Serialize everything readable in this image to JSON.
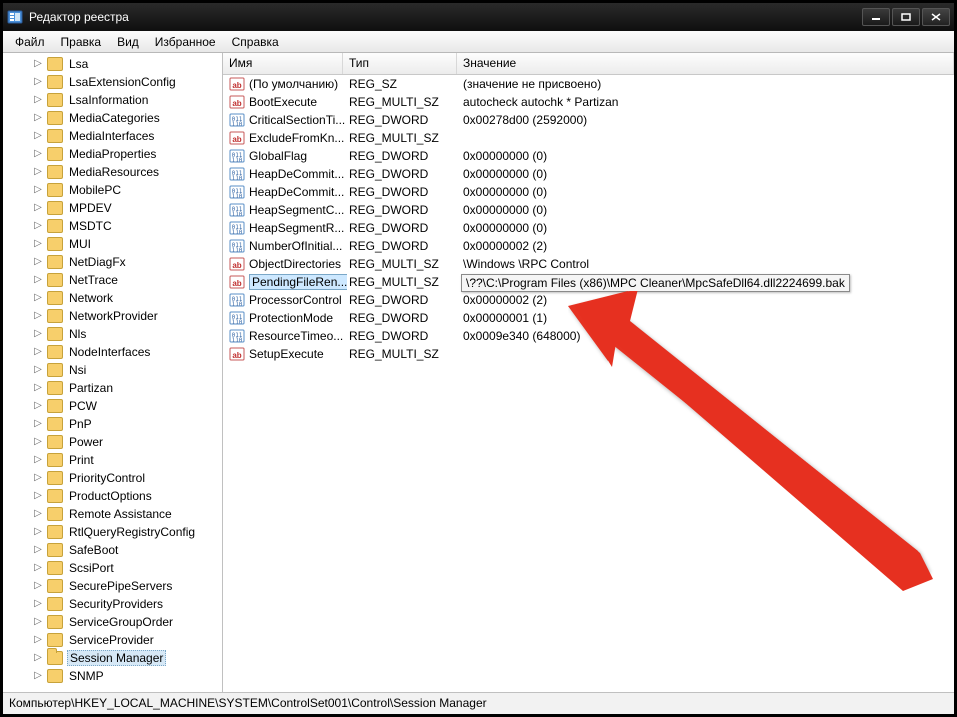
{
  "window": {
    "title": "Редактор реестра"
  },
  "menu": {
    "file": "Файл",
    "edit": "Правка",
    "view": "Вид",
    "favorites": "Избранное",
    "help": "Справка"
  },
  "columns": {
    "name": "Имя",
    "type": "Тип",
    "value": "Значение"
  },
  "tree": [
    {
      "label": "Lsa",
      "selected": false
    },
    {
      "label": "LsaExtensionConfig",
      "selected": false
    },
    {
      "label": "LsaInformation",
      "selected": false
    },
    {
      "label": "MediaCategories",
      "selected": false
    },
    {
      "label": "MediaInterfaces",
      "selected": false
    },
    {
      "label": "MediaProperties",
      "selected": false
    },
    {
      "label": "MediaResources",
      "selected": false
    },
    {
      "label": "MobilePC",
      "selected": false
    },
    {
      "label": "MPDEV",
      "selected": false
    },
    {
      "label": "MSDTC",
      "selected": false
    },
    {
      "label": "MUI",
      "selected": false
    },
    {
      "label": "NetDiagFx",
      "selected": false
    },
    {
      "label": "NetTrace",
      "selected": false
    },
    {
      "label": "Network",
      "selected": false
    },
    {
      "label": "NetworkProvider",
      "selected": false
    },
    {
      "label": "Nls",
      "selected": false
    },
    {
      "label": "NodeInterfaces",
      "selected": false
    },
    {
      "label": "Nsi",
      "selected": false
    },
    {
      "label": "Partizan",
      "selected": false
    },
    {
      "label": "PCW",
      "selected": false
    },
    {
      "label": "PnP",
      "selected": false
    },
    {
      "label": "Power",
      "selected": false
    },
    {
      "label": "Print",
      "selected": false
    },
    {
      "label": "PriorityControl",
      "selected": false
    },
    {
      "label": "ProductOptions",
      "selected": false
    },
    {
      "label": "Remote Assistance",
      "selected": false
    },
    {
      "label": "RtlQueryRegistryConfig",
      "selected": false
    },
    {
      "label": "SafeBoot",
      "selected": false
    },
    {
      "label": "ScsiPort",
      "selected": false
    },
    {
      "label": "SecurePipeServers",
      "selected": false
    },
    {
      "label": "SecurityProviders",
      "selected": false
    },
    {
      "label": "ServiceGroupOrder",
      "selected": false
    },
    {
      "label": "ServiceProvider",
      "selected": false
    },
    {
      "label": "Session Manager",
      "selected": true
    },
    {
      "label": "SNMP",
      "selected": false
    }
  ],
  "rows": [
    {
      "icon": "str",
      "name": "(По умолчанию)",
      "type": "REG_SZ",
      "value": "(значение не присвоено)",
      "selected": false
    },
    {
      "icon": "str",
      "name": "BootExecute",
      "type": "REG_MULTI_SZ",
      "value": "autocheck autochk * Partizan",
      "selected": false
    },
    {
      "icon": "bin",
      "name": "CriticalSectionTi...",
      "type": "REG_DWORD",
      "value": "0x00278d00 (2592000)",
      "selected": false
    },
    {
      "icon": "str",
      "name": "ExcludeFromKn...",
      "type": "REG_MULTI_SZ",
      "value": "",
      "selected": false
    },
    {
      "icon": "bin",
      "name": "GlobalFlag",
      "type": "REG_DWORD",
      "value": "0x00000000 (0)",
      "selected": false
    },
    {
      "icon": "bin",
      "name": "HeapDeCommit...",
      "type": "REG_DWORD",
      "value": "0x00000000 (0)",
      "selected": false
    },
    {
      "icon": "bin",
      "name": "HeapDeCommit...",
      "type": "REG_DWORD",
      "value": "0x00000000 (0)",
      "selected": false
    },
    {
      "icon": "bin",
      "name": "HeapSegmentC...",
      "type": "REG_DWORD",
      "value": "0x00000000 (0)",
      "selected": false
    },
    {
      "icon": "bin",
      "name": "HeapSegmentR...",
      "type": "REG_DWORD",
      "value": "0x00000000 (0)",
      "selected": false
    },
    {
      "icon": "bin",
      "name": "NumberOfInitial...",
      "type": "REG_DWORD",
      "value": "0x00000002 (2)",
      "selected": false
    },
    {
      "icon": "str",
      "name": "ObjectDirectories",
      "type": "REG_MULTI_SZ",
      "value": "\\Windows \\RPC Control",
      "selected": false
    },
    {
      "icon": "str",
      "name": "PendingFileRen...",
      "type": "REG_MULTI_SZ",
      "value": "",
      "selected": true
    },
    {
      "icon": "bin",
      "name": "ProcessorControl",
      "type": "REG_DWORD",
      "value": "0x00000002 (2)",
      "selected": false
    },
    {
      "icon": "bin",
      "name": "ProtectionMode",
      "type": "REG_DWORD",
      "value": "0x00000001 (1)",
      "selected": false
    },
    {
      "icon": "bin",
      "name": "ResourceTimeo...",
      "type": "REG_DWORD",
      "value": "0x0009e340 (648000)",
      "selected": false
    },
    {
      "icon": "str",
      "name": "SetupExecute",
      "type": "REG_MULTI_SZ",
      "value": "",
      "selected": false
    }
  ],
  "tooltip": "\\??\\C:\\Program Files (x86)\\MPC Cleaner\\MpcSafeDll64.dll2224699.bak",
  "status": "Компьютер\\HKEY_LOCAL_MACHINE\\SYSTEM\\ControlSet001\\Control\\Session Manager"
}
